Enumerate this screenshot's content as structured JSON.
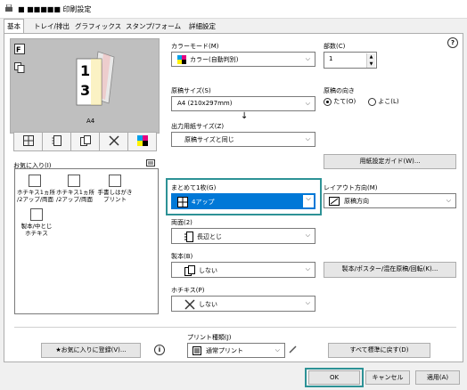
{
  "window": {
    "title": "■ ■■■■■ 印刷設定"
  },
  "tabs": [
    {
      "label": "基本"
    },
    {
      "label": "トレイ/排出"
    },
    {
      "label": "グラフィックス"
    },
    {
      "label": "スタンプ/フォーム"
    },
    {
      "label": "詳細設定"
    }
  ],
  "preview": {
    "paper_label": "A4",
    "page_numbers": [
      "1",
      "3"
    ]
  },
  "favorites": {
    "label": "お気に入り(I)",
    "items": [
      {
        "label": "ホチキス1ヵ所\n/2アップ/両面"
      },
      {
        "label": "ホチキス1ヵ所\n/2アップ/両面"
      },
      {
        "label": "手書しはがき\nプリント"
      },
      {
        "label": "製本/中とじ\nホチキス"
      }
    ],
    "register_button": "★お気に入りに登録(V)..."
  },
  "color_mode": {
    "label": "カラーモード(M)",
    "value": "カラー(自動判別)"
  },
  "copies": {
    "label": "部数(C)",
    "value": "1"
  },
  "original_size": {
    "label": "原稿サイズ(S)",
    "value": "A4 (210x297mm)"
  },
  "orientation": {
    "label": "原稿の向き",
    "options": [
      "たて(O)",
      "よこ(L)"
    ],
    "selected": 0
  },
  "arrow": "↓",
  "output_size": {
    "label": "出力用紙サイズ(Z)",
    "value": "原稿サイズと同じ"
  },
  "paper_guide_button": "用紙設定ガイド(W)...",
  "nup": {
    "label": "まとめて1枚(G)",
    "value": "4アップ"
  },
  "layout_direction": {
    "label": "レイアウト方向(M)",
    "value": "原稿方向"
  },
  "duplex": {
    "label": "両面(2)",
    "value": "長辺とじ"
  },
  "booklet": {
    "label": "製本(B)",
    "value": "しない"
  },
  "booklet_button": "製本/ポスター/混在原稿/回転(K)...",
  "staple": {
    "label": "ホチキス(P)",
    "value": "しない"
  },
  "print_type": {
    "label": "プリント種類(J)",
    "value": "通常プリント"
  },
  "reset_button": "すべて標準に戻す(D)",
  "footer": {
    "ok": "OK",
    "cancel": "キャンセル",
    "apply": "適用(A)"
  },
  "help_icon_glyph": "?",
  "info_icon_glyph": "i",
  "colors": {
    "accent": "#2d9296",
    "selection": "#0078d7"
  }
}
